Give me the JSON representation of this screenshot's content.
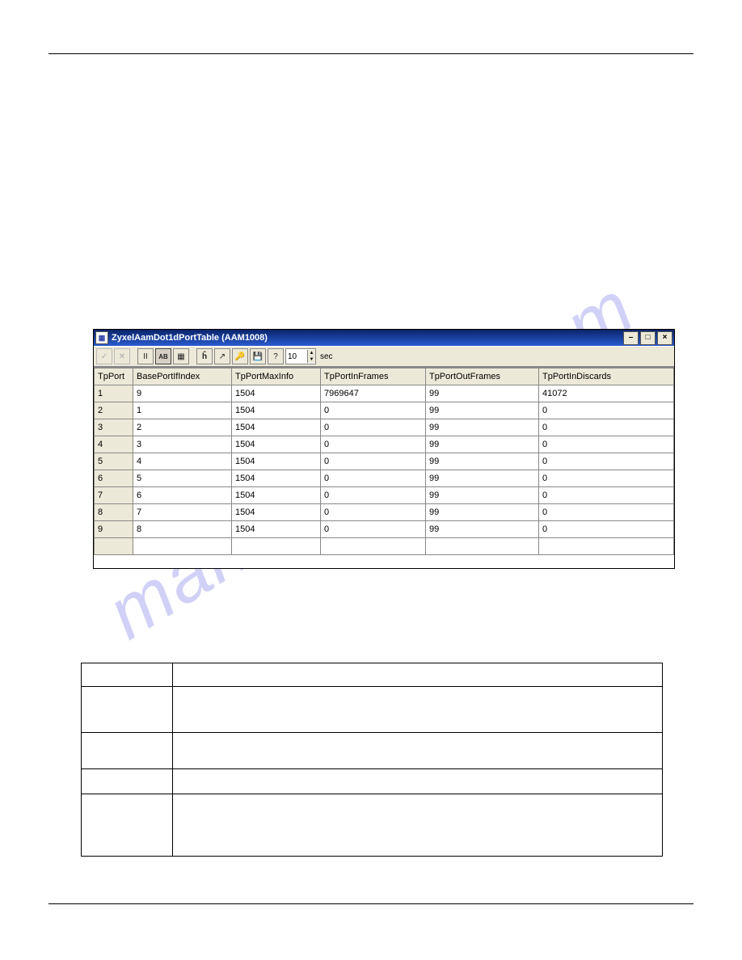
{
  "watermark": "manualshive.com",
  "window": {
    "title": "ZyxelAamDot1dPortTable (AAM1008)",
    "icon_glyph": "▦",
    "buttons": {
      "min_glyph": "–",
      "max_glyph": "□",
      "close_glyph": "×"
    }
  },
  "toolbar": {
    "check": "✓",
    "x": "✕",
    "pause": "II",
    "ab": "AB",
    "grid": "▦",
    "find": "🔍",
    "chart": "↗",
    "key": "🔑",
    "save": "💾",
    "help": "?",
    "spin_value": "10",
    "spin_up": "▲",
    "spin_down": "▼",
    "sec_label": "sec"
  },
  "table": {
    "columns": [
      "TpPort",
      "BasePortIfIndex",
      "TpPortMaxInfo",
      "TpPortInFrames",
      "TpPortOutFrames",
      "TpPortInDiscards"
    ],
    "rows": [
      [
        "1",
        "9",
        "1504",
        "7969647",
        "99",
        "41072"
      ],
      [
        "2",
        "1",
        "1504",
        "0",
        "99",
        "0"
      ],
      [
        "3",
        "2",
        "1504",
        "0",
        "99",
        "0"
      ],
      [
        "4",
        "3",
        "1504",
        "0",
        "99",
        "0"
      ],
      [
        "5",
        "4",
        "1504",
        "0",
        "99",
        "0"
      ],
      [
        "6",
        "5",
        "1504",
        "0",
        "99",
        "0"
      ],
      [
        "7",
        "6",
        "1504",
        "0",
        "99",
        "0"
      ],
      [
        "8",
        "7",
        "1504",
        "0",
        "99",
        "0"
      ],
      [
        "9",
        "8",
        "1504",
        "0",
        "99",
        "0"
      ],
      [
        "",
        "",
        "",
        "",
        "",
        ""
      ]
    ]
  }
}
